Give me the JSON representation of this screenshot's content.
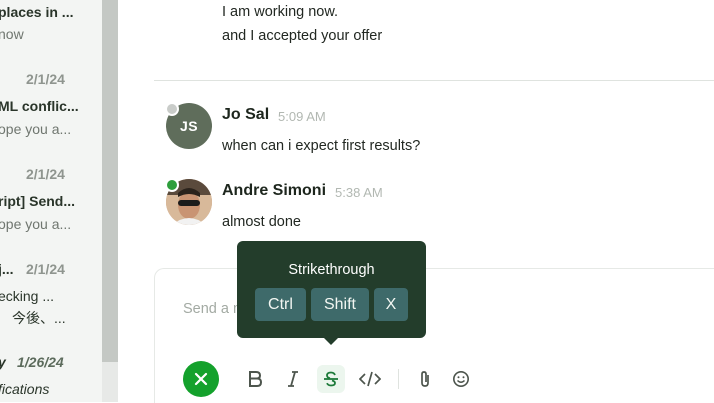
{
  "sidebar": {
    "items": [
      {
        "title": "places in ...",
        "subtitle": "now"
      },
      {
        "date": "2/1/24",
        "title": "ML conflic...",
        "subtitle": "ope you a..."
      },
      {
        "date": "2/1/24",
        "title": "ript] Send...",
        "subtitle": "ope you a..."
      },
      {
        "date": "2/1/24",
        "title": "j...",
        "subtitle": "ecking ...",
        "subtitle2": "今後、..."
      },
      {
        "date": "1/26/24",
        "title": "y",
        "subtitle": "fications"
      }
    ]
  },
  "messages": {
    "prev_line1": "I am working now.",
    "prev_line2": "and I accepted your offer",
    "js": {
      "initials": "JS",
      "name": "Jo Sal",
      "time": "5:09 AM",
      "text": "when can i expect first results?"
    },
    "as": {
      "name": "Andre Simoni",
      "time": "5:38 AM",
      "text": "almost done"
    }
  },
  "composer": {
    "placeholder": "Send a message",
    "send_icon": "close-x-icon",
    "tools": [
      "bold-icon",
      "italic-icon",
      "strikethrough-icon",
      "code-icon",
      "attach-icon",
      "emoji-icon"
    ]
  },
  "tooltip": {
    "title": "Strikethrough",
    "keys": [
      "Ctrl",
      "Shift",
      "X"
    ]
  },
  "colors": {
    "send_button": "#14a12c",
    "tooltip_bg": "#233d2b",
    "kbd_bg": "#3e6a6a",
    "online_dot": "#2e9e3c",
    "offline_dot": "#c9ccc9"
  }
}
